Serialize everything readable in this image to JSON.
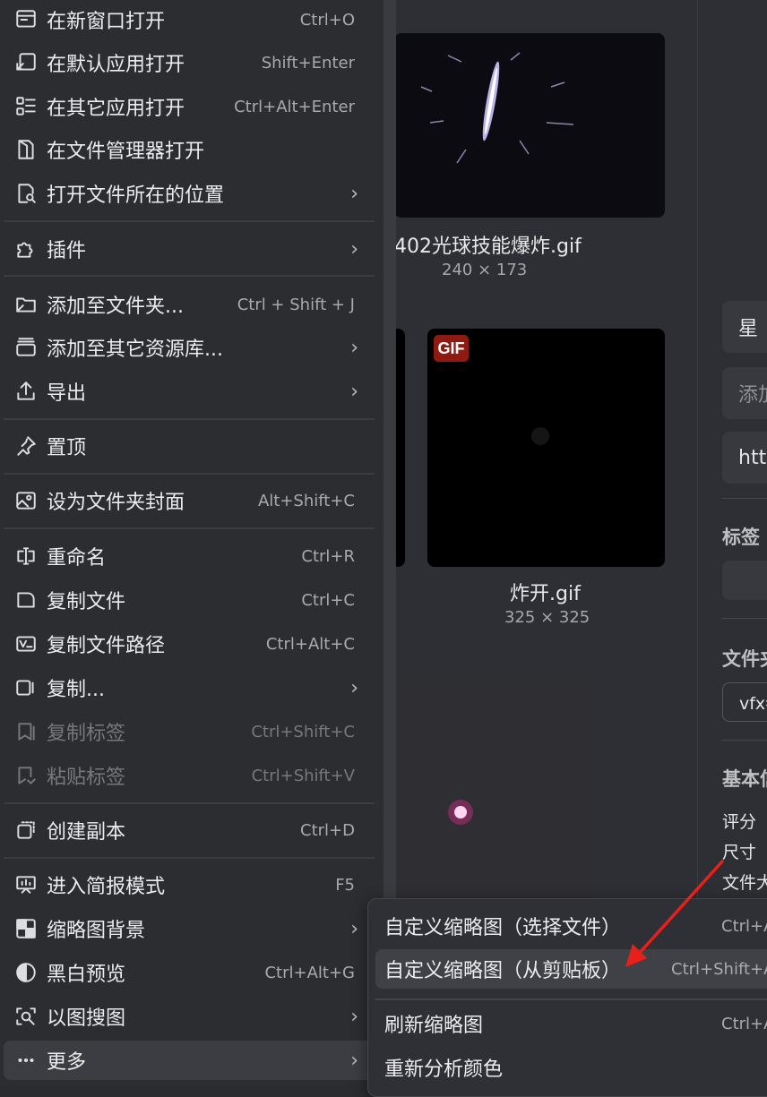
{
  "menu": {
    "items": [
      {
        "label": "在新窗口打开",
        "shortcut": "Ctrl+O"
      },
      {
        "label": "在默认应用打开",
        "shortcut": "Shift+Enter"
      },
      {
        "label": "在其它应用打开",
        "shortcut": "Ctrl+Alt+Enter"
      },
      {
        "label": "在文件管理器打开",
        "shortcut": ""
      },
      {
        "label": "打开文件所在的位置",
        "shortcut": "›"
      },
      {
        "label": "插件",
        "shortcut": "›"
      },
      {
        "label": "添加至文件夹...",
        "shortcut": "Ctrl + Shift + J"
      },
      {
        "label": "添加至其它资源库...",
        "shortcut": "›"
      },
      {
        "label": "导出",
        "shortcut": "›"
      },
      {
        "label": "置顶",
        "shortcut": ""
      },
      {
        "label": "设为文件夹封面",
        "shortcut": "Alt+Shift+C"
      },
      {
        "label": "重命名",
        "shortcut": "Ctrl+R"
      },
      {
        "label": "复制文件",
        "shortcut": "Ctrl+C"
      },
      {
        "label": "复制文件路径",
        "shortcut": "Ctrl+Alt+C"
      },
      {
        "label": "复制...",
        "shortcut": "›"
      },
      {
        "label": "复制标签",
        "shortcut": "Ctrl+Shift+C"
      },
      {
        "label": "粘贴标签",
        "shortcut": "Ctrl+Shift+V"
      },
      {
        "label": "创建副本",
        "shortcut": "Ctrl+D"
      },
      {
        "label": "进入简报模式",
        "shortcut": "F5"
      },
      {
        "label": "缩略图背景",
        "shortcut": "›"
      },
      {
        "label": "黑白预览",
        "shortcut": "Ctrl+Alt+G"
      },
      {
        "label": "以图搜图",
        "shortcut": "›"
      },
      {
        "label": "更多",
        "shortcut": "›"
      }
    ]
  },
  "submenu": {
    "items": [
      {
        "label": "自定义缩略图（选择文件）",
        "shortcut": "Ctrl+A"
      },
      {
        "label": "自定义缩略图（从剪贴板）",
        "shortcut": "Ctrl+Shift+A"
      },
      {
        "label": "刷新缩略图",
        "shortcut": "Ctrl+A"
      },
      {
        "label": "重新分析颜色",
        "shortcut": ""
      }
    ]
  },
  "grid": {
    "file1": {
      "name": "402光球技能爆炸.gif",
      "dims": "240 × 173"
    },
    "file2": {
      "name": "炸开.gif",
      "dims": "325 × 325",
      "badge": "GIF"
    }
  },
  "right_panel": {
    "box1": "星 ",
    "box2": "添加",
    "box3": "htt",
    "tags_head": "标签",
    "folder_head": "文件夹",
    "folder_value": "vfx参",
    "basic_head": "基本信",
    "rating": "评分",
    "size": "尺寸",
    "filesize": "文件大"
  },
  "colors": {
    "annotation_arrow": "#e8201a",
    "gif_badge": "#8e1a12"
  }
}
